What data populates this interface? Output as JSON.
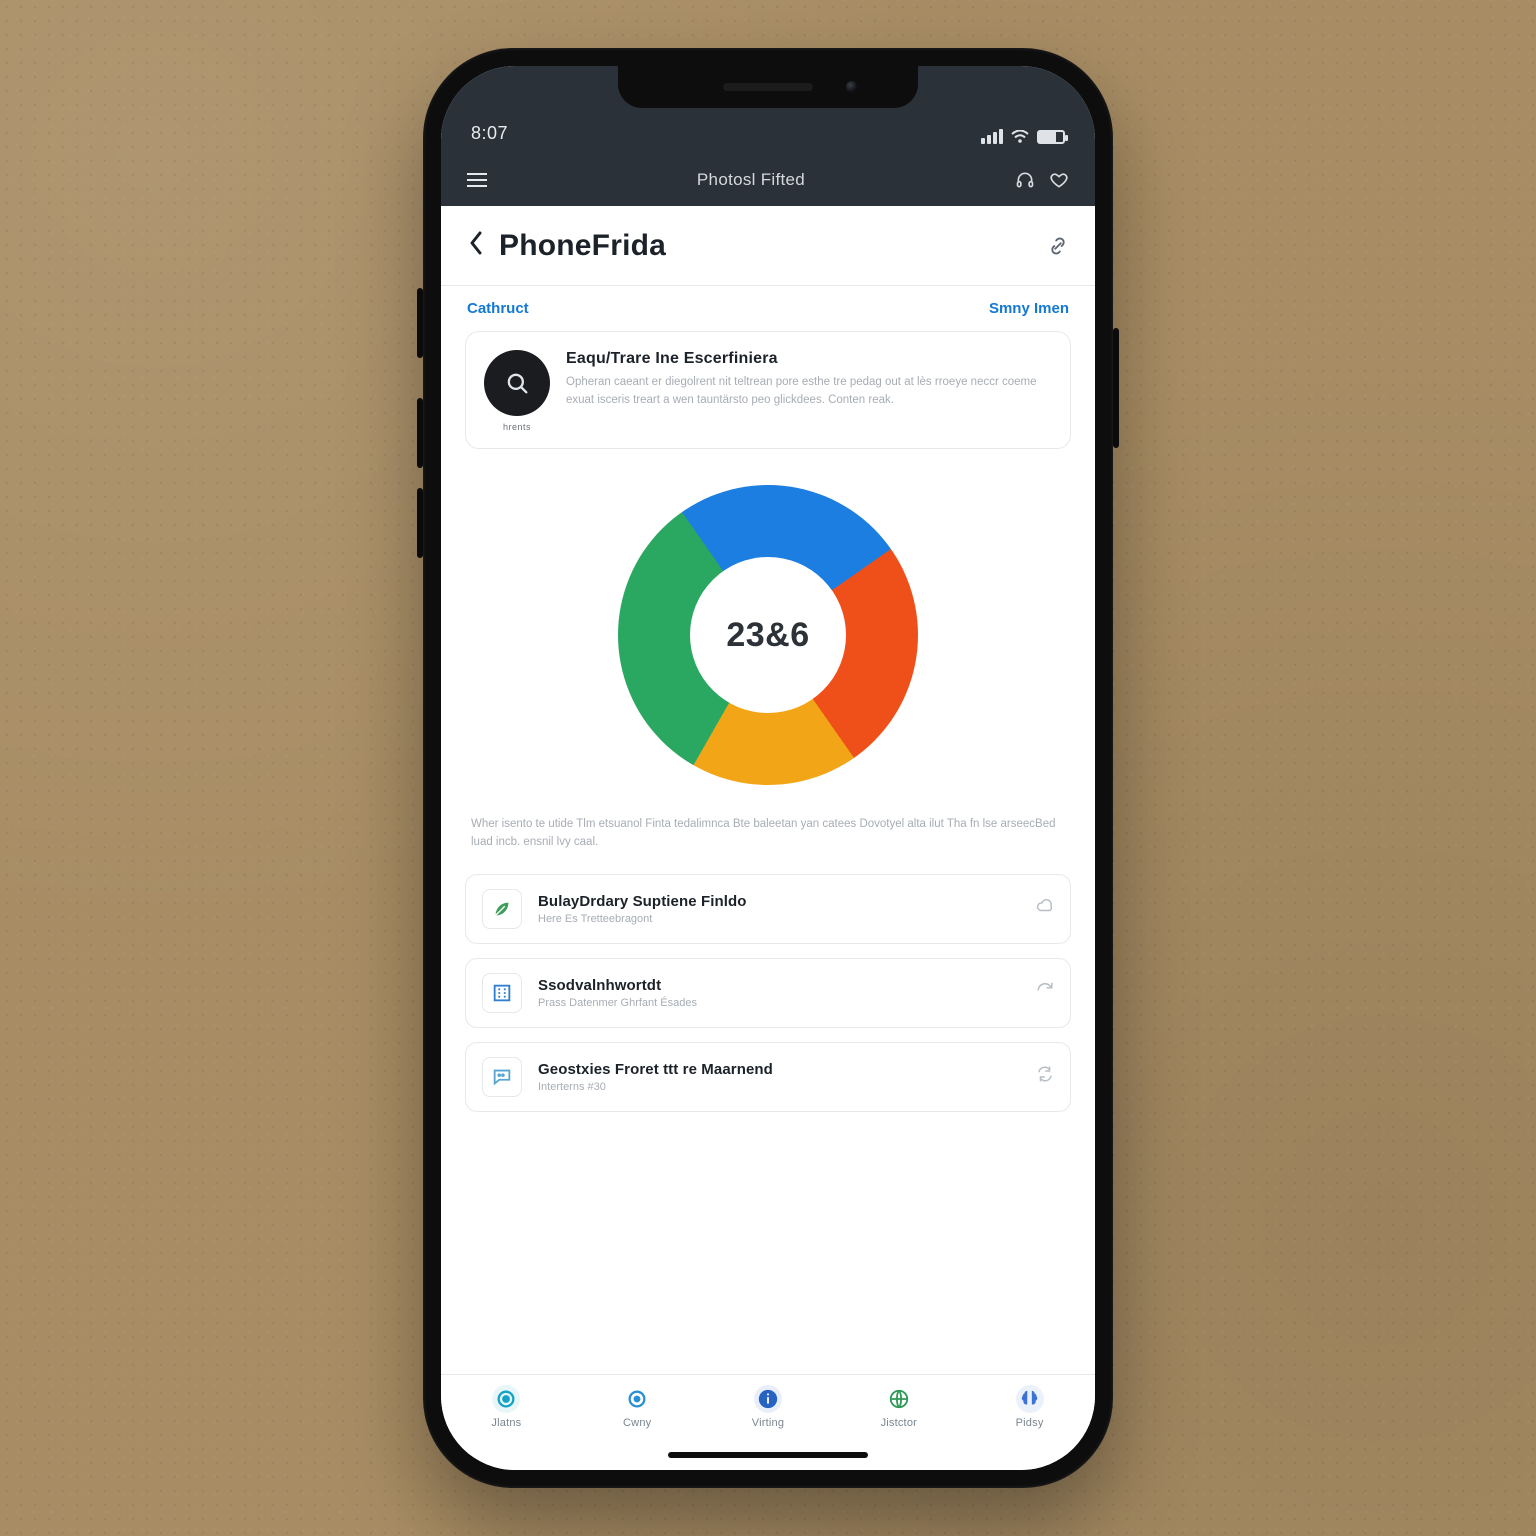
{
  "status": {
    "time": "8:07",
    "system_title": "Photosl Fifted",
    "system_icons": [
      "headset-icon",
      "heart-icon"
    ]
  },
  "app_header": {
    "title": "PhoneFrida",
    "left_link": "Cathruct",
    "right_link": "Smny Imen"
  },
  "info_card": {
    "title": "Eaqu/Trare Ine Escerfiniera",
    "body": "Opheran caeant er diegolrent nit teltrean pore esthe tre pedag out at lès rroeye neccr coeme exuat isceris treart a wen tauntärsto peo glickdees. Conten reak.",
    "avatar_caption": "hrents"
  },
  "chart_data": {
    "type": "donut",
    "center_label": "23&6",
    "series": [
      {
        "name": "blue",
        "value": 25,
        "color": "#1b7ee0"
      },
      {
        "name": "orange",
        "value": 25,
        "color": "#ef5019"
      },
      {
        "name": "yellow",
        "value": 18,
        "color": "#f2a516"
      },
      {
        "name": "green",
        "value": 32,
        "color": "#2aa761"
      }
    ],
    "caption": "Wher isento te utide Tlm etsuanol Finta tedalimnca Bte baleetan yan catees Dovotyel alta ilut Tha fn lse arseecBed luad incb. ensnil lvy caal."
  },
  "features": [
    {
      "icon": "leaf-icon",
      "icon_color": "#3f9e5b",
      "title": "BulayDrdary Suptiene Finldo",
      "subtitle": "Here Es Tretteebragont",
      "trail_icon": "cloud-icon"
    },
    {
      "icon": "building-icon",
      "icon_color": "#2f7ecf",
      "title": "Ssodvalnhwortdt",
      "subtitle": "Prass Datenmer Ghrfant Ésades",
      "trail_icon": "refresh-icon"
    },
    {
      "icon": "chat-icon",
      "icon_color": "#55a6d0",
      "title": "Geostxies Froret ttt re Maarnend",
      "subtitle": "Interterns #30",
      "trail_icon": "sync-icon"
    }
  ],
  "tabs": [
    {
      "icon": "target-icon",
      "label": "Jlatns",
      "color": "#14a3c4",
      "fill": true
    },
    {
      "icon": "record-icon",
      "label": "Cwny",
      "color": "#2b8fd1",
      "fill": false
    },
    {
      "icon": "info-icon",
      "label": "Virting",
      "color": "#2763c2",
      "fill": true
    },
    {
      "icon": "globe-icon",
      "label": "Jistctor",
      "color": "#2f9a58",
      "fill": false
    },
    {
      "icon": "brain-icon",
      "label": "Pidsy",
      "color": "#3a72d6",
      "fill": true
    }
  ]
}
